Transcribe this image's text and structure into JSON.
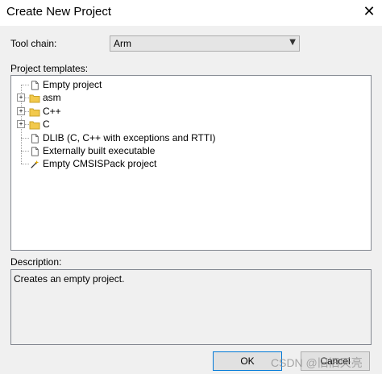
{
  "window": {
    "title": "Create New Project",
    "close_glyph": "✕"
  },
  "toolchain": {
    "label": "Tool chain:",
    "value": "Arm",
    "arrow_glyph": "▼"
  },
  "templates": {
    "label": "Project templates:",
    "items": [
      {
        "label": "Empty project",
        "icon": "document-icon"
      },
      {
        "label": "asm",
        "icon": "folder-icon",
        "expander": "+"
      },
      {
        "label": "C++",
        "icon": "folder-icon",
        "expander": "+"
      },
      {
        "label": "C",
        "icon": "folder-icon",
        "expander": "+"
      },
      {
        "label": "DLIB (C, C++ with exceptions and RTTI)",
        "icon": "document-icon"
      },
      {
        "label": "Externally built executable",
        "icon": "document-icon"
      },
      {
        "label": "Empty CMSISPack project",
        "icon": "wand-icon"
      }
    ]
  },
  "description": {
    "label": "Description:",
    "text": "Creates an empty project."
  },
  "buttons": {
    "ok": "OK",
    "cancel": "Cancel"
  },
  "watermark": "CSDN @旧旧天亮",
  "colors": {
    "folder": "#f2c94c",
    "accent": "#0078d7"
  }
}
